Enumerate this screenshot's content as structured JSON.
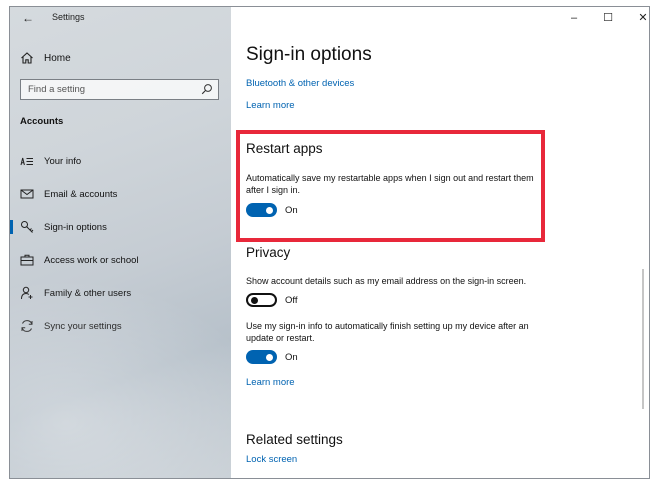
{
  "window": {
    "app_title": "Settings",
    "controls": {
      "minimize": "–",
      "maximize": "☐",
      "close": "✕"
    }
  },
  "sidebar": {
    "home_label": "Home",
    "search_placeholder": "Find a setting",
    "section_title": "Accounts",
    "items": [
      {
        "label": "Your info",
        "icon": "person-card-icon"
      },
      {
        "label": "Email & accounts",
        "icon": "mail-icon"
      },
      {
        "label": "Sign-in options",
        "icon": "key-icon",
        "selected": true
      },
      {
        "label": "Access work or school",
        "icon": "briefcase-icon"
      },
      {
        "label": "Family & other users",
        "icon": "person-add-icon"
      },
      {
        "label": "Sync your settings",
        "icon": "sync-icon"
      }
    ]
  },
  "main": {
    "page_title": "Sign-in options",
    "links_top": [
      "Bluetooth & other devices",
      "Learn more"
    ],
    "restart_apps": {
      "heading": "Restart apps",
      "description": "Automatically save my restartable apps when I sign out and restart them after I sign in.",
      "toggle_state": "On"
    },
    "privacy": {
      "heading": "Privacy",
      "option1": {
        "description": "Show account details such as my email address on the sign-in screen.",
        "toggle_state": "Off"
      },
      "option2": {
        "description": "Use my sign-in info to automatically finish setting up my device after an update or restart.",
        "toggle_state": "On"
      },
      "learn_more": "Learn more"
    },
    "related": {
      "heading": "Related settings",
      "link": "Lock screen"
    }
  },
  "colors": {
    "accent": "#0063b1",
    "highlight": "#e8283a"
  }
}
